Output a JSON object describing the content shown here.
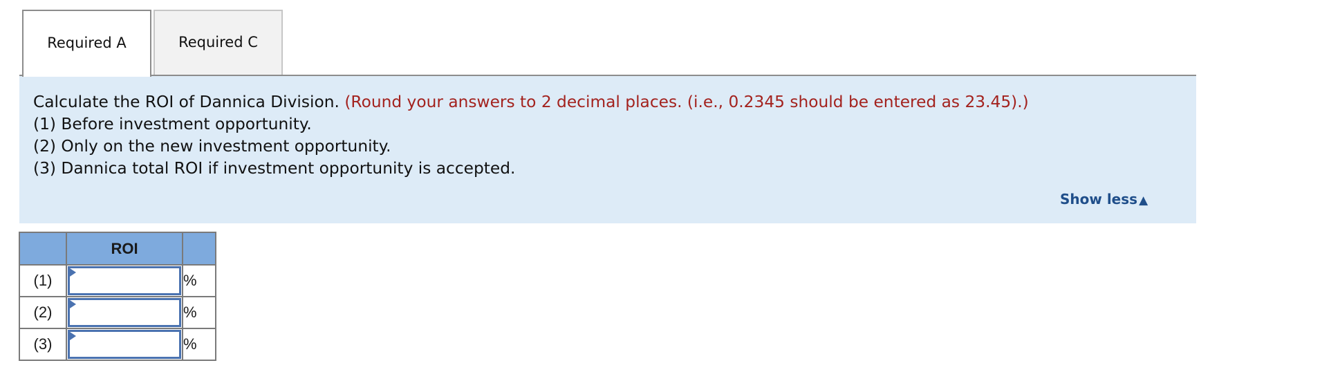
{
  "tabs": [
    {
      "label": "Required A",
      "active": true
    },
    {
      "label": "Required C",
      "active": false
    }
  ],
  "instructions": {
    "main": "Calculate the ROI of Dannica Division.",
    "note": "(Round your answers to 2 decimal places. (i.e., 0.2345 should be entered as 23.45).)",
    "items": [
      "(1) Before investment opportunity.",
      "(2) Only on the new investment opportunity.",
      "(3) Dannica total ROI if investment opportunity is accepted."
    ],
    "toggle_label": "Show less",
    "toggle_icon": "▲"
  },
  "table": {
    "headers": [
      "",
      "ROI",
      ""
    ],
    "rows": [
      {
        "label": "(1)",
        "value": "",
        "unit": "%"
      },
      {
        "label": "(2)",
        "value": "",
        "unit": "%"
      },
      {
        "label": "(3)",
        "value": "",
        "unit": "%"
      }
    ]
  },
  "colors": {
    "instructions_bg": "#ddebf7",
    "note_text": "#a3221e",
    "link": "#1f4e8a",
    "table_header": "#7eaadd",
    "input_border": "#4a72b0"
  }
}
